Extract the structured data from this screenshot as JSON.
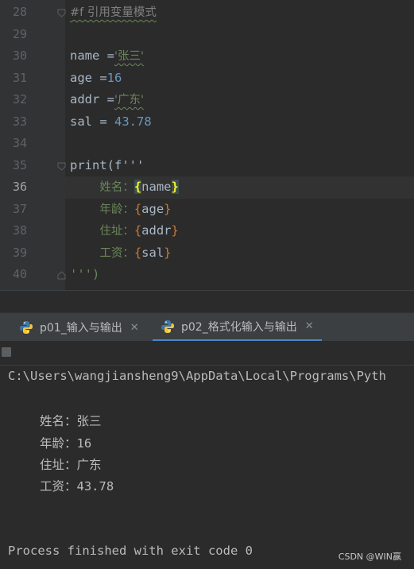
{
  "editor": {
    "lines": [
      {
        "num": "28",
        "comment": "#f 引用变量模式"
      },
      {
        "num": "29"
      },
      {
        "num": "30",
        "var": "name",
        "op": " =",
        "str": "'张三'"
      },
      {
        "num": "31",
        "var": "age",
        "op": " =",
        "numval": "16"
      },
      {
        "num": "32",
        "var": "addr",
        "op": " =",
        "str": "'广东'"
      },
      {
        "num": "33",
        "var": "sal",
        "op": " = ",
        "numval": "43.78"
      },
      {
        "num": "34"
      },
      {
        "num": "35",
        "code": "print(f'''"
      },
      {
        "num": "36",
        "label": "姓名：",
        "ref": "name"
      },
      {
        "num": "37",
        "label": "年龄：",
        "ref": "age"
      },
      {
        "num": "38",
        "label": "住址：",
        "ref": "addr"
      },
      {
        "num": "39",
        "label": "工资：",
        "ref": "sal"
      },
      {
        "num": "40",
        "code": "''')"
      }
    ]
  },
  "tabs": [
    {
      "label": "p01_输入与输出",
      "close": "✕"
    },
    {
      "label": "p02_格式化输入与输出",
      "close": "✕"
    }
  ],
  "console": {
    "command": "C:\\Users\\wangjiansheng9\\AppData\\Local\\Programs\\Pyth",
    "output": [
      {
        "label": "姓名：",
        "value": "张三"
      },
      {
        "label": "年龄：",
        "value": "16"
      },
      {
        "label": "住址：",
        "value": "广东"
      },
      {
        "label": "工资：",
        "value": "43.78"
      }
    ],
    "finished": "Process finished with exit code 0"
  },
  "watermark": "CSDN @WIN赢"
}
